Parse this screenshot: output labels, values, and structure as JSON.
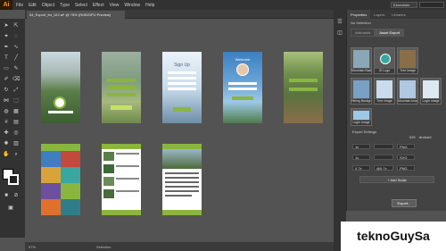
{
  "app": {
    "logo": "Ai"
  },
  "menu": [
    "File",
    "Edit",
    "Object",
    "Type",
    "Select",
    "Effect",
    "View",
    "Window",
    "Help"
  ],
  "workspace": "Essentials",
  "document_tab": "04_Export_for_UI2.ai* @ 75% (RGB/GPU Preview)",
  "status": {
    "zoom": "57%",
    "mode": "Selection"
  },
  "panel": {
    "tabs": [
      "Properties",
      "Layers",
      "Libraries"
    ],
    "active_tab": "Properties",
    "section": "No Selection",
    "asset_tabs": [
      "Artboards",
      "Asset Export"
    ],
    "active_asset_tab": "Asset Export",
    "thumbs": [
      "Mountain Background",
      "ID Logo",
      "Tree image",
      "Hiking Backgr...",
      "Tree image",
      "Mountain Image",
      "Login image",
      "Login Image"
    ],
    "export_settings_label": "Export Settings",
    "ios_label": "iOS",
    "android_label": "Android",
    "scale_rows": [
      {
        "scale": "1x",
        "suffix": "",
        "format": "PNG"
      },
      {
        "scale": "1x",
        "suffix": "",
        "format": "SVG"
      },
      {
        "scale": "0.7x",
        "suffix": "@0.7x",
        "format": "PNG"
      }
    ],
    "add_scale": "+ Add Scale",
    "export_button": "Export..."
  },
  "artboards": {
    "login_title": "Sign Up",
    "welcome_title": "Welcome"
  },
  "watermark": "teknoGuySa",
  "colors": {
    "ui_dark": "#323232",
    "canvas": "#535353",
    "accent_green": "#8ab63f",
    "accent_orange": "#ff9a00"
  }
}
